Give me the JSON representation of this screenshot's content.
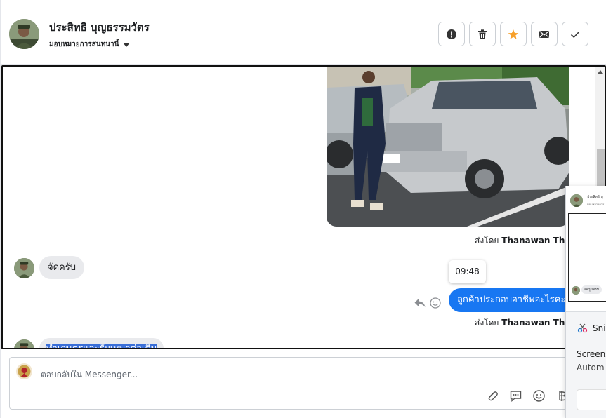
{
  "header": {
    "name": "ประสิทธิ บุญธรรมวัตร",
    "subtitle": "มอบหมายการสนทนานี้",
    "actions": [
      {
        "icon": "alert-icon"
      },
      {
        "icon": "trash-icon"
      },
      {
        "icon": "star-icon"
      },
      {
        "icon": "mail-icon"
      },
      {
        "icon": "check-icon"
      }
    ]
  },
  "colors": {
    "accent": "#1877f2",
    "star": "#f7a02a",
    "bubble_in": "#e9eaed"
  },
  "messages": {
    "photo_sent_by_prefix": "ส่งโดย",
    "photo_sent_by_name": "Thanawan Thon",
    "incoming_1": "จัดครับ",
    "timestamp": "09:48",
    "outgoing_1": "ลูกค้าประกอบอาชีพอะไรคะ",
    "outgoing_sent_by_prefix": "ส่งโดย",
    "outgoing_sent_by_name": "Thanawan Thon",
    "incoming_2": "ทำเกษตรและรับเหมาต่อเติม"
  },
  "composer": {
    "placeholder": "ตอบกลับใน Messenger..."
  },
  "overlay": {
    "preview_name": "ประสิทธิ บุ",
    "preview_sub": "มอบหมายการ",
    "preview_bubble": "จัดรูปิดรับ",
    "snip_title": "Snip",
    "line1": "Screens",
    "line2": "Autom"
  }
}
